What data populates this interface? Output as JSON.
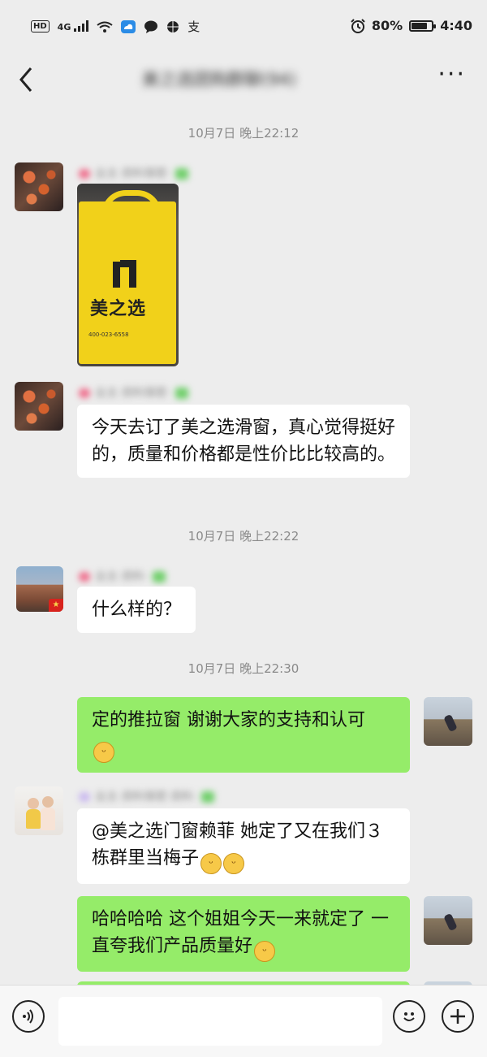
{
  "status_bar": {
    "network": "HD",
    "signal": "4G",
    "battery": "80%",
    "battery_level": 0.8,
    "time": "4:40",
    "icons": [
      "hd-icon",
      "signal-icon",
      "wifi-icon",
      "cloud-icon",
      "message-icon",
      "basketball-icon",
      "alipay-icon",
      "alarm-icon",
      "battery-icon"
    ]
  },
  "header": {
    "back_icon": "back-arrow-icon",
    "title": "美之选团购群聊(94)",
    "more_icon": "more-dots-icon"
  },
  "messages": {
    "ts1": "10月7日 晚上22:12",
    "m1_name": "业主",
    "m1_bag_brand": "美之选",
    "m1_bag_tel": "400-023-6558",
    "m2_name": "业主",
    "m2_text": "今天去订了美之选滑窗，真心觉得挺好的，质量和价格都是性价比比较高的。",
    "ts2": "10月7日 晚上22:22",
    "m3_name": "业主",
    "m3_text": "什么样的？",
    "ts3": "10月7日 晚上22:30",
    "m4_text": "定的推拉窗 谢谢大家的支持和认可",
    "m5_name": "业主",
    "m5_text": "@美之选门窗赖菲  她定了又在我们３栋群里当梅子",
    "m6_text": "哈哈哈哈  这个姐姐今天一来就定了 一直夸我们产品质量好"
  },
  "input_bar": {
    "voice_icon": "voice-icon",
    "placeholder": "",
    "emoji_icon": "emoji-icon",
    "plus_icon": "plus-icon"
  }
}
